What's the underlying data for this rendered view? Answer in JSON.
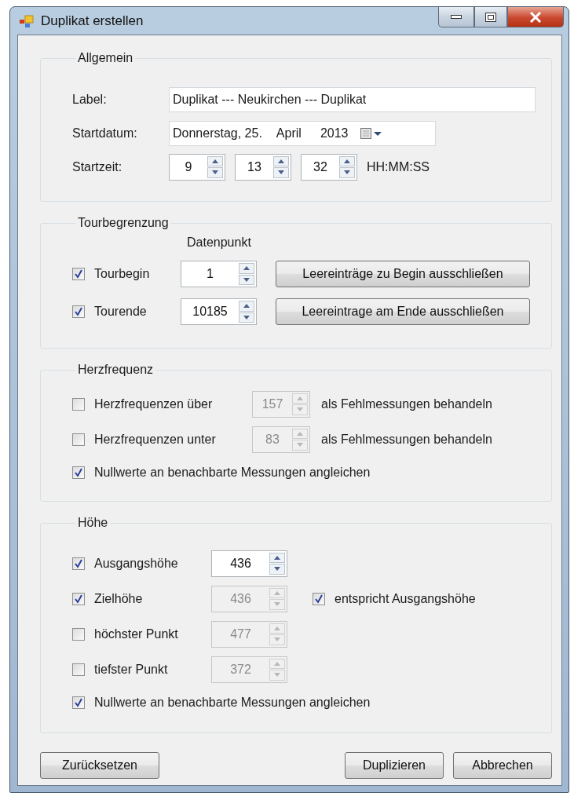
{
  "window": {
    "title": "Duplikat erstellen"
  },
  "general": {
    "title": "Allgemein",
    "label": {
      "caption": "Label:",
      "value": "Duplikat --- Neukirchen --- Duplikat"
    },
    "start_date": {
      "caption": "Startdatum:",
      "day": "Donnerstag, 25.",
      "month": "April",
      "year": "2013"
    },
    "start_time": {
      "caption": "Startzeit:",
      "fields": [
        "9",
        "13",
        "32"
      ],
      "format": "HH:MM:SS"
    }
  },
  "tour_limits": {
    "title": "Tourbegrenzung",
    "column_header": "Datenpunkt",
    "rows": [
      {
        "label": "Tourbegin",
        "checked": true,
        "value": "1",
        "button": "Leereinträge zu Begin ausschließen"
      },
      {
        "label": "Tourende",
        "checked": true,
        "value": "10185",
        "button": "Leereintrage am Ende ausschließen"
      }
    ]
  },
  "heart_rate": {
    "title": "Herzfrequenz",
    "rows": [
      {
        "kind": "threshold",
        "label": "Herzfrequenzen über",
        "checked": false,
        "value": "157",
        "disabled": true,
        "suffix": "als Fehlmessungen behandeln"
      },
      {
        "kind": "threshold",
        "label": "Herzfrequenzen unter",
        "checked": false,
        "value": "83",
        "disabled": true,
        "suffix": "als Fehlmessungen behandeln"
      },
      {
        "kind": "option",
        "label": "Nullwerte an benachbarte Messungen angleichen",
        "checked": true
      }
    ]
  },
  "altitude": {
    "title": "Höhe",
    "rows": [
      {
        "kind": "value",
        "label": "Ausgangshöhe",
        "checked": true,
        "value": "436",
        "disabled": false
      },
      {
        "kind": "value",
        "label": "Zielhöhe",
        "checked": true,
        "value": "436",
        "disabled": true,
        "extra": {
          "label": "entspricht Ausgangshöhe",
          "checked": true
        }
      },
      {
        "kind": "value",
        "label": "höchster Punkt",
        "checked": false,
        "value": "477",
        "disabled": true
      },
      {
        "kind": "value",
        "label": "tiefster Punkt",
        "checked": false,
        "value": "372",
        "disabled": true
      },
      {
        "kind": "option",
        "label": "Nullwerte an benachbarte Messungen angleichen",
        "checked": true
      }
    ]
  },
  "footer": {
    "left": [
      "Zurücksetzen"
    ],
    "right": [
      "Duplizieren",
      "Abbrechen"
    ]
  }
}
